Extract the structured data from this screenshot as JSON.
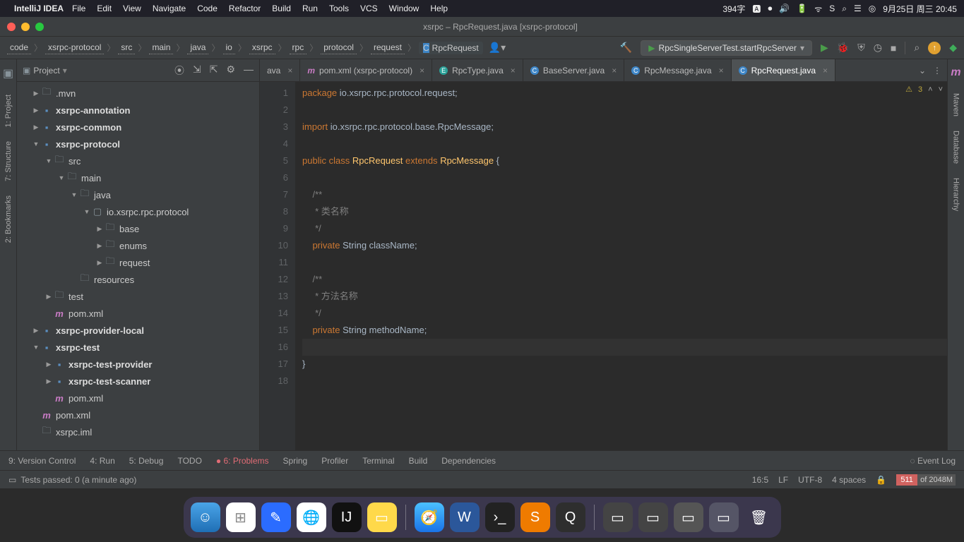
{
  "macos": {
    "app": "IntelliJ IDEA",
    "menus": [
      "File",
      "Edit",
      "View",
      "Navigate",
      "Code",
      "Refactor",
      "Build",
      "Run",
      "Tools",
      "VCS",
      "Window",
      "Help"
    ],
    "status": {
      "ime": "394字",
      "date": "9月25日 周三 20:45"
    }
  },
  "window_title": "xsrpc – RpcRequest.java [xsrpc-protocol]",
  "breadcrumbs": [
    "code",
    "xsrpc-protocol",
    "src",
    "main",
    "java",
    "io",
    "xsrpc",
    "rpc",
    "protocol",
    "request",
    "RpcRequest"
  ],
  "run_config": "RpcSingleServerTest.startRpcServer",
  "project": {
    "label": "Project",
    "tree": [
      {
        "d": 0,
        "a": ">",
        "t": "folder",
        "n": ".mvn"
      },
      {
        "d": 0,
        "a": ">",
        "t": "mod",
        "n": "xsrpc-annotation",
        "b": true
      },
      {
        "d": 0,
        "a": ">",
        "t": "mod",
        "n": "xsrpc-common",
        "b": true
      },
      {
        "d": 0,
        "a": "v",
        "t": "mod",
        "n": "xsrpc-protocol",
        "b": true
      },
      {
        "d": 1,
        "a": "v",
        "t": "folder",
        "n": "src"
      },
      {
        "d": 2,
        "a": "v",
        "t": "folder",
        "n": "main"
      },
      {
        "d": 3,
        "a": "v",
        "t": "folder",
        "n": "java"
      },
      {
        "d": 4,
        "a": "v",
        "t": "pkg",
        "n": "io.xsrpc.rpc.protocol"
      },
      {
        "d": 5,
        "a": ">",
        "t": "folder",
        "n": "base"
      },
      {
        "d": 5,
        "a": ">",
        "t": "folder",
        "n": "enums"
      },
      {
        "d": 5,
        "a": ">",
        "t": "folder",
        "n": "request"
      },
      {
        "d": 3,
        "a": "",
        "t": "folder",
        "n": "resources"
      },
      {
        "d": 1,
        "a": ">",
        "t": "folder",
        "n": "test"
      },
      {
        "d": 1,
        "a": "",
        "t": "m",
        "n": "pom.xml"
      },
      {
        "d": 0,
        "a": ">",
        "t": "mod",
        "n": "xsrpc-provider-local",
        "b": true
      },
      {
        "d": 0,
        "a": "v",
        "t": "mod",
        "n": "xsrpc-test",
        "b": true
      },
      {
        "d": 1,
        "a": ">",
        "t": "mod",
        "n": "xsrpc-test-provider",
        "b": true
      },
      {
        "d": 1,
        "a": ">",
        "t": "mod",
        "n": "xsrpc-test-scanner",
        "b": true
      },
      {
        "d": 1,
        "a": "",
        "t": "m",
        "n": "pom.xml"
      },
      {
        "d": 0,
        "a": "",
        "t": "m",
        "n": "pom.xml"
      },
      {
        "d": 0,
        "a": "",
        "t": "file",
        "n": "xsrpc.iml"
      }
    ]
  },
  "tabs": [
    {
      "icon": "",
      "label": "ava",
      "active": false
    },
    {
      "icon": "mag",
      "label": "pom.xml (xsrpc-protocol)",
      "active": false
    },
    {
      "icon": "teal",
      "label": "RpcType.java",
      "active": false
    },
    {
      "icon": "blue",
      "label": "BaseServer.java",
      "active": false
    },
    {
      "icon": "blue",
      "label": "RpcMessage.java",
      "active": false
    },
    {
      "icon": "blue",
      "label": "RpcRequest.java",
      "active": true
    }
  ],
  "warn_count": "3",
  "code": {
    "lines": [
      {
        "n": 1,
        "h": "<span class='kw'>package</span> io.xsrpc.rpc.protocol.request;"
      },
      {
        "n": 2,
        "h": ""
      },
      {
        "n": 3,
        "h": "<span class='kw'>import</span> io.xsrpc.rpc.protocol.base.RpcMessage;"
      },
      {
        "n": 4,
        "h": ""
      },
      {
        "n": 5,
        "h": "<span class='kw'>public</span> <span class='kw'>class</span> <span class='cls'>RpcRequest</span> <span class='kw'>extends</span> <span class='cls'>RpcMessage</span> {"
      },
      {
        "n": 6,
        "h": ""
      },
      {
        "n": 7,
        "h": "    <span class='cmt'>/**</span>"
      },
      {
        "n": 8,
        "h": "    <span class='cmt'> * 类名称</span>"
      },
      {
        "n": 9,
        "h": "    <span class='cmt'> */</span>"
      },
      {
        "n": 10,
        "h": "    <span class='kw'>private</span> String className;"
      },
      {
        "n": 11,
        "h": ""
      },
      {
        "n": 12,
        "h": "    <span class='cmt'>/**</span>"
      },
      {
        "n": 13,
        "h": "    <span class='cmt'> * 方法名称</span>"
      },
      {
        "n": 14,
        "h": "    <span class='cmt'> */</span>"
      },
      {
        "n": 15,
        "h": "    <span class='kw'>private</span> String methodName;"
      },
      {
        "n": 16,
        "h": "",
        "curr": true
      },
      {
        "n": 17,
        "h": "}"
      },
      {
        "n": 18,
        "h": ""
      }
    ]
  },
  "bottom_tools": [
    {
      "l": "9: Version Control"
    },
    {
      "l": "4: Run"
    },
    {
      "l": "5: Debug"
    },
    {
      "l": "TODO"
    },
    {
      "l": "6: Problems",
      "red": true
    },
    {
      "l": "Spring"
    },
    {
      "l": "Profiler"
    },
    {
      "l": "Terminal"
    },
    {
      "l": "Build"
    },
    {
      "l": "Dependencies"
    }
  ],
  "event_log": "Event Log",
  "status": {
    "msg": "Tests passed: 0 (a minute ago)",
    "pos": "16:5",
    "sep": "LF",
    "enc": "UTF-8",
    "indent": "4 spaces",
    "lock": "🔒",
    "mem_used": "511",
    "mem_total": "of 2048M"
  },
  "left_tabs": [
    "1: Project",
    "7: Structure",
    "2: Bookmarks"
  ],
  "right_tabs": [
    "Maven",
    "Database",
    "Hierarchy"
  ]
}
